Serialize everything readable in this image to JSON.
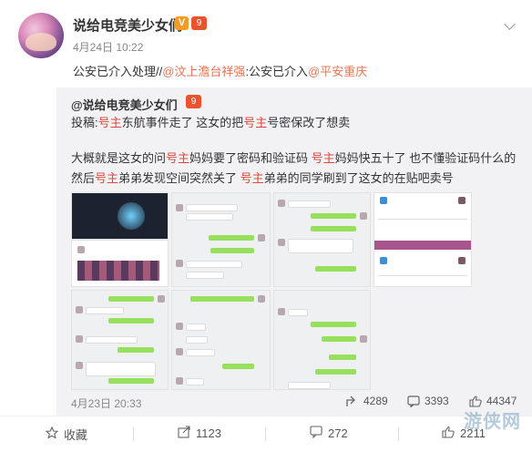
{
  "post": {
    "username": "说给电竞美少女们",
    "v_badge": "V",
    "level_badge": "9",
    "time": "4月24日 10:22",
    "text_prefix": "公安已介入处理//",
    "mention1": "@汶上澹台祥强",
    "text_mid": ":公安已介入",
    "mention2": "@平安重庆"
  },
  "repost": {
    "username": "@说给电竞美少女们",
    "level_badge": "9",
    "line1_a": "投稿:",
    "line1_red1": "号主",
    "line1_b": "东航事件走了 这女的把",
    "line1_red2": "号主",
    "line1_c": "号密保改了想卖",
    "para_a": "大概就是这女的问",
    "para_red1": "号主",
    "para_b": "妈妈要了密码和验证码 ",
    "para_red2": "号主",
    "para_c": "妈妈快五十了 也不懂验证码什么的 然后",
    "para_red3": "号主",
    "para_d": "弟弟发现空间突然关了 ",
    "para_red4": "号主",
    "para_e": "弟弟的同学刷到了这女的在贴吧卖号",
    "date": "4月23日 20:33",
    "share_count": "4289",
    "comment_count": "3393",
    "like_count": "44347"
  },
  "footer": {
    "favorite_label": "收藏",
    "share_count": "1123",
    "comment_count": "272",
    "like_count": "2211"
  },
  "watermark": "游侠网",
  "colors": {
    "mention": "#eb7350",
    "highlight": "#e2463a",
    "wechat_bubble": "#96e05e"
  }
}
